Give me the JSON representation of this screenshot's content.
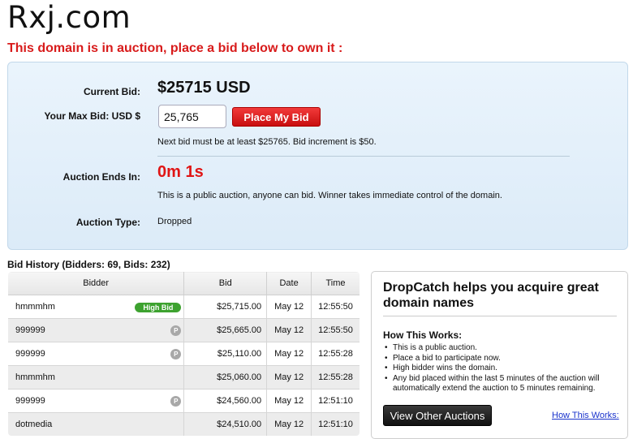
{
  "page": {
    "domain": "Rxj.com",
    "headline": "This domain is in auction, place a bid below to own it :"
  },
  "bid_panel": {
    "current_bid_label": "Current Bid:",
    "current_bid_value": "$25715 USD",
    "max_bid_label": "Your Max Bid: USD $",
    "max_bid_value": "25,765",
    "place_bid_label": "Place My Bid",
    "next_bid_note": "Next bid must be at least $25765. Bid increment is $50.",
    "ends_label": "Auction Ends In:",
    "ends_value": "0m 1s",
    "public_note": "This is a public auction, anyone can bid. Winner takes immediate control of the domain.",
    "type_label": "Auction Type:",
    "type_value": "Dropped"
  },
  "history": {
    "title": "Bid History (Bidders: 69, Bids: 232)",
    "headers": {
      "bidder": "Bidder",
      "bid": "Bid",
      "date": "Date",
      "time": "Time"
    },
    "high_bid_badge": "High Bid",
    "proxy_icon_glyph": "P",
    "rows": [
      {
        "bidder": "hmmmhm",
        "bid": "$25,715.00",
        "date": "May 12",
        "time": "12:55:50",
        "badge": "high-bid"
      },
      {
        "bidder": "999999",
        "bid": "$25,665.00",
        "date": "May 12",
        "time": "12:55:50",
        "badge": "proxy"
      },
      {
        "bidder": "999999",
        "bid": "$25,110.00",
        "date": "May 12",
        "time": "12:55:28",
        "badge": "proxy"
      },
      {
        "bidder": "hmmmhm",
        "bid": "$25,060.00",
        "date": "May 12",
        "time": "12:55:28",
        "badge": "none"
      },
      {
        "bidder": "999999",
        "bid": "$24,560.00",
        "date": "May 12",
        "time": "12:51:10",
        "badge": "proxy"
      },
      {
        "bidder": "dotmedia",
        "bid": "$24,510.00",
        "date": "May 12",
        "time": "12:51:10",
        "badge": "none"
      }
    ]
  },
  "info": {
    "title": "DropCatch helps you acquire great domain names",
    "how_title": "How This Works:",
    "how_items": [
      "This is a public auction.",
      "Place a bid to participate now.",
      "High bidder wins the domain.",
      "Any bid placed within the last 5 minutes of the auction will automatically extend the auction to 5 minutes remaining."
    ],
    "view_other_label": "View Other Auctions",
    "how_link_label": "How This Works:"
  },
  "colors": {
    "headline_red": "#d81b1b",
    "panel_bg": "#e4f0fa",
    "bid_button_red": "#e02020",
    "high_bid_green": "#3da22f",
    "link_blue": "#1a33cc"
  }
}
